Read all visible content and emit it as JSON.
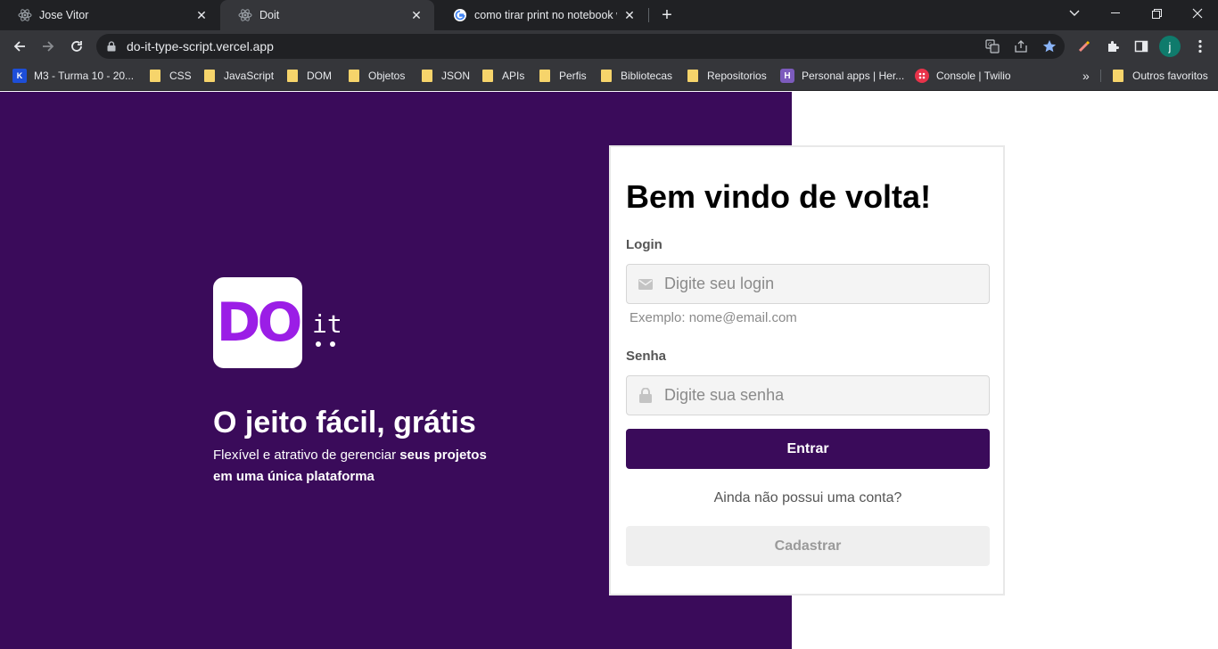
{
  "browser": {
    "tabs": [
      {
        "title": "Jose Vitor",
        "icon": "react-icon",
        "active": false
      },
      {
        "title": "Doit",
        "icon": "react-icon",
        "active": true
      },
      {
        "title": "como tirar print no notebook win",
        "icon": "google-icon",
        "active": false
      }
    ],
    "url": "do-it-type-script.vercel.app",
    "profile_initial": "j",
    "bookmarks": [
      {
        "label": "M3 - Turma 10 - 20...",
        "icon": "kenzie-icon"
      },
      {
        "label": "CSS",
        "icon": "folder-icon"
      },
      {
        "label": "JavaScript",
        "icon": "folder-icon"
      },
      {
        "label": "DOM",
        "icon": "folder-icon"
      },
      {
        "label": "Objetos",
        "icon": "folder-icon"
      },
      {
        "label": "JSON",
        "icon": "folder-icon"
      },
      {
        "label": "APIs",
        "icon": "folder-icon"
      },
      {
        "label": "Perfis",
        "icon": "folder-icon"
      },
      {
        "label": "Bibliotecas",
        "icon": "folder-icon"
      },
      {
        "label": "Repositorios",
        "icon": "folder-icon"
      },
      {
        "label": "Personal apps | Her...",
        "icon": "heroku-icon"
      },
      {
        "label": "Console | Twilio",
        "icon": "twilio-icon"
      }
    ],
    "bookmarks_overflow": "»",
    "other_bookmarks": "Outros favoritos"
  },
  "hero": {
    "logo_text": "DO",
    "logo_suffix": "it",
    "title": "O jeito fácil, grátis",
    "subtitle_plain": "Flexível e atrativo de gerenciar ",
    "subtitle_bold_1": "seus projetos",
    "subtitle_bold_2": "em uma única plataforma"
  },
  "login_form": {
    "heading": "Bem vindo de volta!",
    "login_label": "Login",
    "login_placeholder": "Digite seu login",
    "login_hint": "Exemplo: nome@email.com",
    "password_label": "Senha",
    "password_placeholder": "Digite sua senha",
    "submit_label": "Entrar",
    "signup_question": "Ainda não possui uma conta?",
    "signup_label": "Cadastrar"
  },
  "colors": {
    "brand_purple": "#3a0b5a",
    "logo_purple": "#9b1ee6",
    "chrome_dark": "#202124",
    "chrome_mid": "#35363a"
  }
}
